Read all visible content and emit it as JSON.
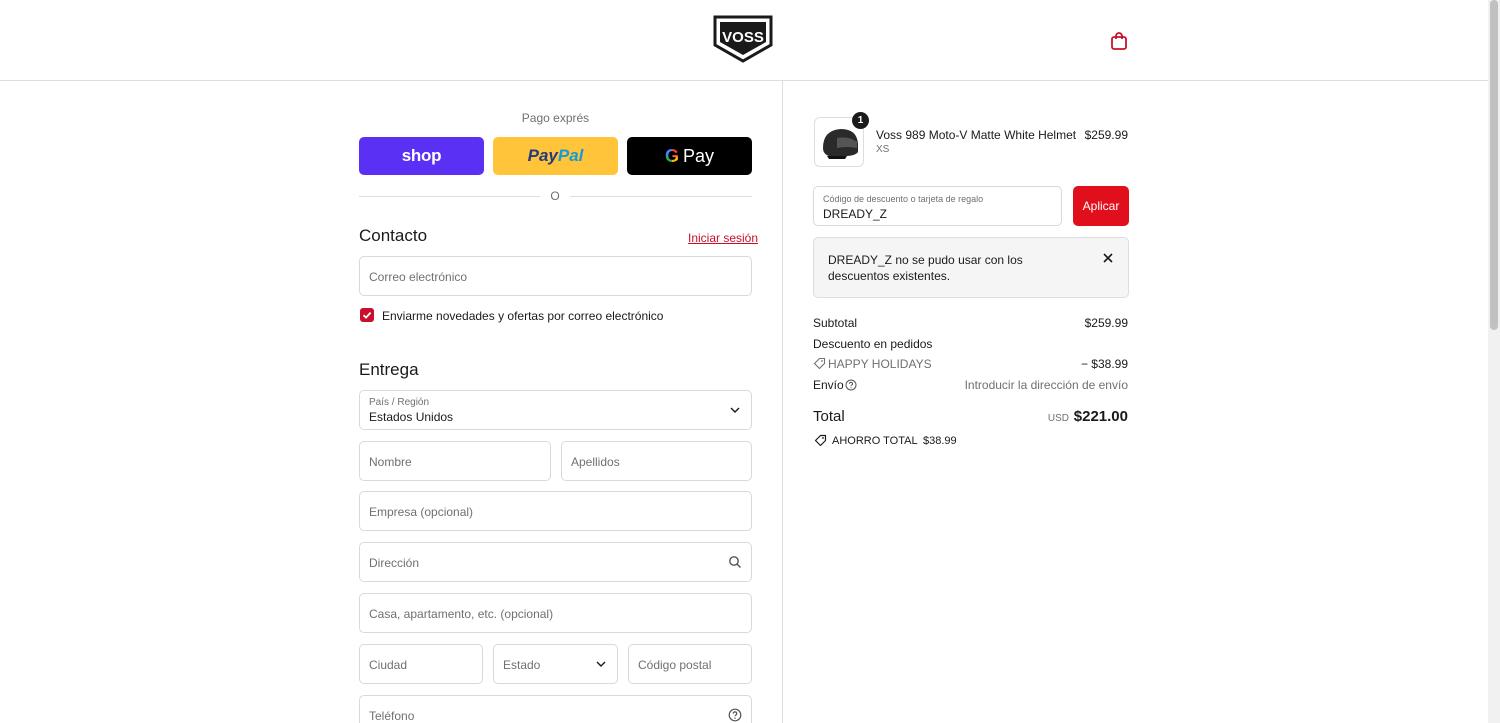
{
  "header": {
    "logo_text": "VOSS"
  },
  "express": {
    "title": "Pago exprés",
    "shop_label": "shop",
    "paypal_label_1": "Pay",
    "paypal_label_2": "Pal",
    "gpay_label": "Pay",
    "divider": "O"
  },
  "contact": {
    "title": "Contacto",
    "login_link": "Iniciar sesión",
    "email_placeholder": "Correo electrónico",
    "newsletter_label": "Enviarme novedades y ofertas por correo electrónico"
  },
  "delivery": {
    "title": "Entrega",
    "country_label": "País / Región",
    "country_value": "Estados Unidos",
    "first_name": "Nombre",
    "last_name": "Apellidos",
    "company": "Empresa (opcional)",
    "address": "Dirección",
    "apartment": "Casa, apartamento, etc. (opcional)",
    "city": "Ciudad",
    "state": "Estado",
    "zip": "Código postal",
    "phone": "Teléfono"
  },
  "summary": {
    "qty": "1",
    "product_name": "Voss 989 Moto-V Matte White Helmet",
    "product_variant": "XS",
    "product_price": "$259.99",
    "discount_label": "Código de descuento o tarjeta de regalo",
    "discount_value": "DREADY_Z",
    "apply": "Aplicar",
    "alert": "DREADY_Z no se pudo usar con los descuentos existentes.",
    "subtotal_label": "Subtotal",
    "subtotal_value": "$259.99",
    "order_discount_label": "Descuento en pedidos",
    "discount_code": "HAPPY HOLIDAYS",
    "discount_amount": "− $38.99",
    "shipping_label": "Envío",
    "shipping_value": "Introducir la dirección de envío",
    "total_label": "Total",
    "currency": "USD",
    "total_value": "$221.00",
    "saving_label": "AHORRO TOTAL",
    "saving_value": "$38.99"
  },
  "colors": {
    "accent": "#c8102e",
    "apply": "#e10f1b",
    "shop": "#5a31f4",
    "paypal": "#ffc439"
  }
}
